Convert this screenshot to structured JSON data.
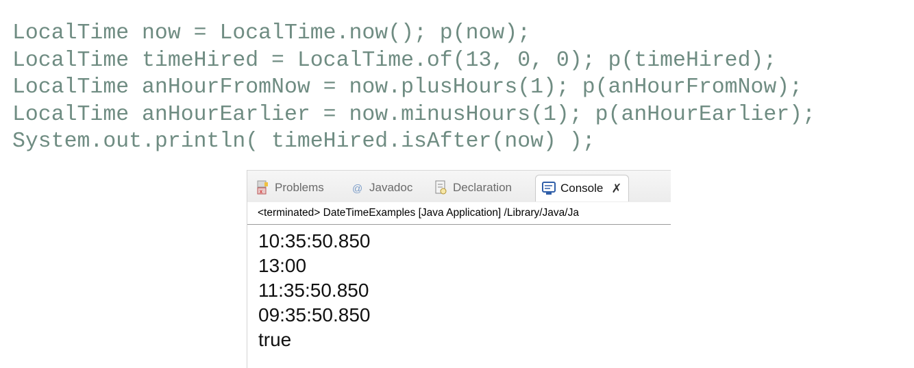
{
  "code": {
    "lines": [
      "LocalTime now = LocalTime.now(); p(now);",
      "LocalTime timeHired = LocalTime.of(13, 0, 0); p(timeHired);",
      "LocalTime anHourFromNow = now.plusHours(1); p(anHourFromNow);",
      "LocalTime anHourEarlier = now.minusHours(1); p(anHourEarlier);",
      "System.out.println( timeHired.isAfter(now) );"
    ]
  },
  "panel": {
    "tabs": [
      {
        "label": "Problems",
        "icon": "problems-icon"
      },
      {
        "label": "Javadoc",
        "icon": "at-icon"
      },
      {
        "label": "Declaration",
        "icon": "declaration-icon"
      },
      {
        "label": "Console",
        "icon": "console-icon",
        "active": true
      }
    ],
    "status": "<terminated> DateTimeExamples [Java Application] /Library/Java/Ja",
    "output": [
      "10:35:50.850",
      "13:00",
      "11:35:50.850",
      "09:35:50.850",
      "true"
    ]
  },
  "colors": {
    "code_text": "#6f8c82",
    "console_text": "#111111"
  }
}
